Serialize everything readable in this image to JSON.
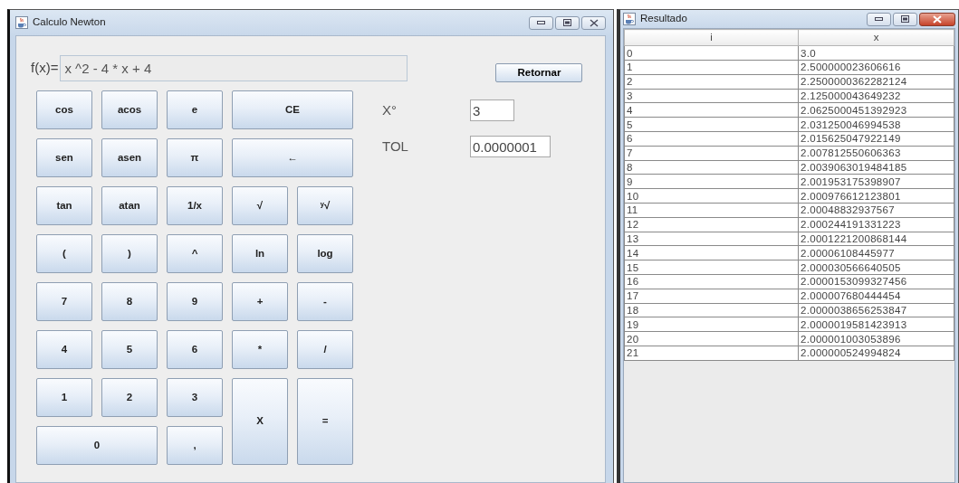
{
  "calculator_window": {
    "title": "Calculo Newton",
    "function_label": "f(x)=",
    "function_value": "x ^2 - 4 * x + 4",
    "return_button": "Retornar",
    "keys": [
      {
        "label": "cos",
        "kind": "normal"
      },
      {
        "label": "acos",
        "kind": "normal"
      },
      {
        "label": "e",
        "kind": "normal"
      },
      {
        "label": "CE",
        "kind": "wide"
      },
      {
        "label": "sen",
        "kind": "normal"
      },
      {
        "label": "asen",
        "kind": "normal"
      },
      {
        "label": "π",
        "kind": "normal"
      },
      {
        "label": "←",
        "kind": "wide"
      },
      {
        "label": "tan",
        "kind": "normal"
      },
      {
        "label": "atan",
        "kind": "normal"
      },
      {
        "label": "1/x",
        "kind": "normal"
      },
      {
        "label": "√",
        "kind": "normal"
      },
      {
        "label": "ʸ√",
        "kind": "normal"
      },
      {
        "label": "(",
        "kind": "normal"
      },
      {
        "label": ")",
        "kind": "normal"
      },
      {
        "label": "^",
        "kind": "normal"
      },
      {
        "label": "ln",
        "kind": "normal"
      },
      {
        "label": "log",
        "kind": "normal"
      },
      {
        "label": "7",
        "kind": "normal"
      },
      {
        "label": "8",
        "kind": "normal"
      },
      {
        "label": "9",
        "kind": "normal"
      },
      {
        "label": "+",
        "kind": "normal"
      },
      {
        "label": "-",
        "kind": "normal"
      },
      {
        "label": "4",
        "kind": "normal"
      },
      {
        "label": "5",
        "kind": "normal"
      },
      {
        "label": "6",
        "kind": "normal"
      },
      {
        "label": "*",
        "kind": "normal"
      },
      {
        "label": "/",
        "kind": "normal"
      },
      {
        "label": "1",
        "kind": "normal"
      },
      {
        "label": "2",
        "kind": "normal"
      },
      {
        "label": "3",
        "kind": "normal"
      },
      {
        "label": "X",
        "kind": "tall"
      },
      {
        "label": "=",
        "kind": "tall"
      },
      {
        "label": "0",
        "kind": "wide"
      },
      {
        "label": ",",
        "kind": "normal"
      }
    ],
    "params": [
      {
        "label": "X°",
        "value": "3"
      },
      {
        "label": "TOL",
        "value": "0.0000001"
      }
    ]
  },
  "result_window": {
    "title": "Resultado",
    "table": {
      "columns": [
        "i",
        "x"
      ],
      "rows": [
        [
          "0",
          "3.0"
        ],
        [
          "1",
          "2.500000023606616"
        ],
        [
          "2",
          "2.2500000362282124"
        ],
        [
          "3",
          "2.125000043649232"
        ],
        [
          "4",
          "2.0625000451392923"
        ],
        [
          "5",
          "2.031250046994538"
        ],
        [
          "6",
          "2.015625047922149"
        ],
        [
          "7",
          "2.007812550606363"
        ],
        [
          "8",
          "2.0039063019484185"
        ],
        [
          "9",
          "2.001953175398907"
        ],
        [
          "10",
          "2.000976612123801"
        ],
        [
          "11",
          "2.00048832937567"
        ],
        [
          "12",
          "2.000244191331223"
        ],
        [
          "13",
          "2.0001221200868144"
        ],
        [
          "14",
          "2.00006108445977"
        ],
        [
          "15",
          "2.000030566640505"
        ],
        [
          "16",
          "2.0000153099327456"
        ],
        [
          "17",
          "2.000007680444454"
        ],
        [
          "18",
          "2.0000038656253847"
        ],
        [
          "19",
          "2.0000019581423913"
        ],
        [
          "20",
          "2.000001003053896"
        ],
        [
          "21",
          "2.000000524994824"
        ]
      ]
    }
  }
}
